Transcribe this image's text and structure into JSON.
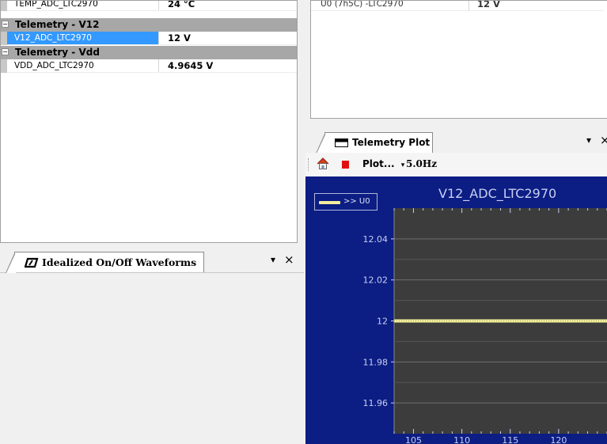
{
  "tree": {
    "rows": [
      {
        "kind": "item",
        "name": "TEMP_ADC_LTC2970",
        "value": "24 °C",
        "selected": false
      },
      {
        "kind": "group",
        "label": "Telemetry - V12"
      },
      {
        "kind": "item",
        "name": "V12_ADC_LTC2970",
        "value": "12 V",
        "selected": true
      },
      {
        "kind": "group",
        "label": "Telemetry - Vdd"
      },
      {
        "kind": "item",
        "name": "VDD_ADC_LTC2970",
        "value": "4.9645 V",
        "selected": false
      }
    ]
  },
  "top_list": {
    "row": {
      "name": "U0 (7h5C) -LTC2970",
      "value": "12 V"
    }
  },
  "idealized_panel": {
    "tab_label": "Idealized On/Off Waveforms",
    "menu_glyph": "▾",
    "close_glyph": "×"
  },
  "plot_panel": {
    "tab_label": "Telemetry Plot",
    "menu_glyph": "▾",
    "close_glyph": "×",
    "toolbar": {
      "plot_menu_label": "Plot...",
      "rate_label": "5.0Hz"
    },
    "colors": {
      "background": "#0c1d84",
      "plot_bg": "#3c3c3c",
      "line": "#f3ef9c",
      "text": "#c8cff0"
    }
  },
  "chart_data": {
    "type": "line",
    "title": "V12_ADC_LTC2970",
    "xlabel": "",
    "ylabel": "",
    "xlim": [
      103,
      125
    ],
    "ylim": [
      11.945,
      12.055
    ],
    "x_ticks": [
      105,
      110,
      115,
      120
    ],
    "y_ticks": [
      12.04,
      12.02,
      12,
      11.98,
      11.96
    ],
    "grid": true,
    "legend_position": "top-left",
    "series": [
      {
        "name": ">> U0",
        "x": [
          103,
          125
        ],
        "y": [
          12,
          12
        ]
      }
    ]
  }
}
